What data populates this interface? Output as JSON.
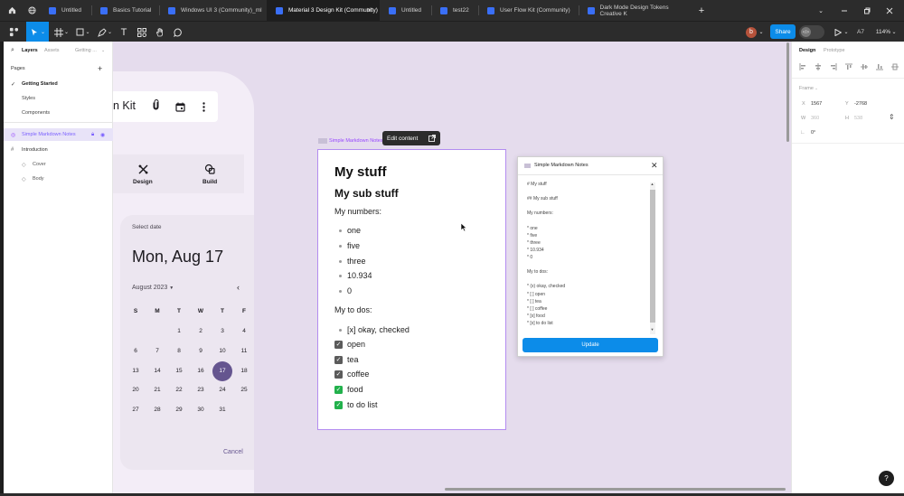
{
  "tabs": [
    {
      "label": "Untitled"
    },
    {
      "label": "Basics Tutorial"
    },
    {
      "label": "Windows UI 3 (Community)_ml"
    },
    {
      "label": "Material 3 Design Kit (Community)"
    },
    {
      "label": "Untitled"
    },
    {
      "label": "test22"
    },
    {
      "label": "User Flow Kit (Community)"
    },
    {
      "label": "Dark Mode Design Tokens Creative K"
    }
  ],
  "toolbar": {
    "share": "Share",
    "avatar": "b",
    "zoom": "114%",
    "a7": "A7"
  },
  "left_panel": {
    "tabs": {
      "layers": "Layers",
      "assets": "Assets",
      "page": "Getting ..."
    },
    "pages_title": "Pages",
    "pages": [
      "Getting Started",
      "Styles",
      "Components"
    ],
    "layers": {
      "selected": "Simple Markdown Notes",
      "intro": "Introduction",
      "cover": "Cover",
      "body": "Body"
    }
  },
  "canvas": {
    "kit_title": "n Kit",
    "design_label": "Design",
    "build_label": "Build",
    "datepicker": {
      "select_date": "Select date",
      "date": "Mon, Aug 17",
      "month": "August 2023",
      "weekdays": [
        "S",
        "M",
        "T",
        "W",
        "T",
        "F"
      ],
      "weeks": [
        [
          "",
          "",
          "1",
          "2",
          "3",
          "4"
        ],
        [
          "6",
          "7",
          "8",
          "9",
          "10",
          "11"
        ],
        [
          "13",
          "14",
          "15",
          "16",
          "17",
          "18"
        ],
        [
          "20",
          "21",
          "22",
          "23",
          "24",
          "25"
        ],
        [
          "27",
          "28",
          "29",
          "30",
          "31",
          ""
        ]
      ],
      "cancel": "Cancel"
    },
    "frame_label": "Simple Markdown Notes",
    "edit_content": "Edit content",
    "md": {
      "h1": "My stuff",
      "h2": "My sub stuff",
      "numbers_title": "My numbers:",
      "numbers": [
        "one",
        "five",
        "three",
        "10.934",
        "0"
      ],
      "todos_title": "My to dos:",
      "first_todo": "[x] okay, checked",
      "todos": [
        {
          "text": "open",
          "color": "#5b5b5b"
        },
        {
          "text": "tea",
          "color": "#5b5b5b"
        },
        {
          "text": "coffee",
          "color": "#5b5b5b"
        },
        {
          "text": "food",
          "color": "#22b14c"
        },
        {
          "text": "to do list",
          "color": "#22b14c"
        }
      ]
    }
  },
  "plugin": {
    "title": "Simple Markdown Notes",
    "lines": [
      "# My stuff",
      "",
      "## My sub stuff",
      "",
      "My numbers:",
      "",
      "* one",
      "* five",
      "* three",
      "* 10.934",
      "* 0",
      "",
      "My to dos:",
      "",
      "* (x) okay, checked",
      "* [ ] open",
      "* [ ] tea",
      "* [ ] coffee",
      "* [x] food",
      "* [x] to do list"
    ],
    "update": "Update"
  },
  "right_panel": {
    "tabs": {
      "design": "Design",
      "prototype": "Prototype"
    },
    "frame": "Frame",
    "x_label": "X",
    "x": "1567",
    "y_label": "Y",
    "y": "-2768",
    "w_label": "W",
    "w": "360",
    "h_label": "H",
    "h": "538",
    "rotation": "0°"
  },
  "help": "?"
}
